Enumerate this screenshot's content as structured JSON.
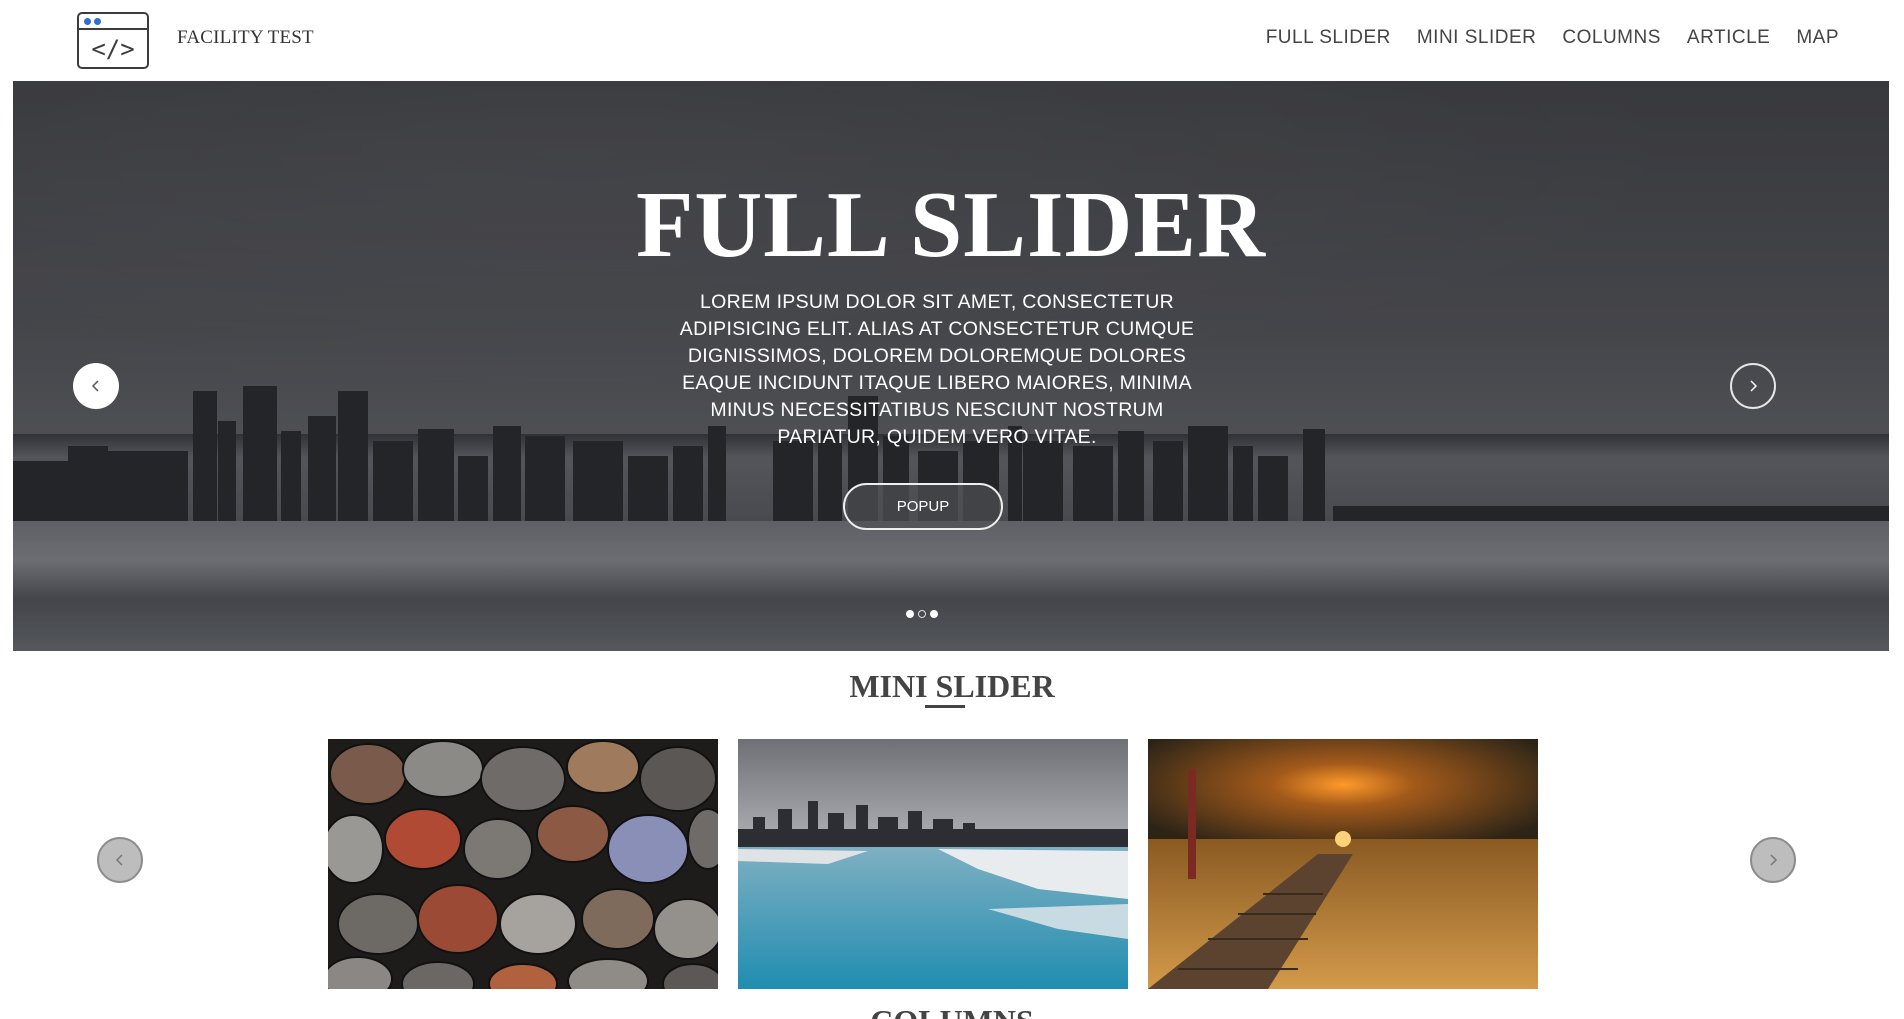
{
  "header": {
    "brand": "FACILITY TEST",
    "logo_icon": "browser-code-icon",
    "logo_code": "</>",
    "nav": [
      {
        "label": "FULL SLIDER"
      },
      {
        "label": "MINI SLIDER"
      },
      {
        "label": "COLUMNS"
      },
      {
        "label": "ARTICLE"
      },
      {
        "label": "MAP"
      }
    ]
  },
  "hero": {
    "title": "FULL SLIDER",
    "text": "LOREM IPSUM DOLOR SIT AMET, CONSECTETUR ADIPISICING ELIT. ALIAS AT CONSECTETUR CUMQUE DIGNISSIMOS, DOLOREM DOLOREMQUE DOLORES EAQUE INCIDUNT ITAQUE LIBERO MAIORES, MINIMA MINUS NECESSITATIBUS NESCIUNT NOSTRUM PARIATUR, QUIDEM VERO VITAE.",
    "button_label": "POPUP",
    "prev_icon": "chevron-left-icon",
    "next_icon": "chevron-right-icon",
    "active_slide": 1,
    "slide_count": 3
  },
  "mini_slider": {
    "title": "MINI SLIDER",
    "images": [
      {
        "name": "pebbles-image"
      },
      {
        "name": "city-lake-image"
      },
      {
        "name": "beach-sunset-image"
      }
    ],
    "prev_icon": "chevron-left-icon",
    "next_icon": "chevron-right-icon"
  },
  "next_section": {
    "title": "COLUMNS"
  },
  "colors": {
    "accent_blue": "#2c6fd6",
    "text_dark": "#333333",
    "white": "#ffffff"
  }
}
